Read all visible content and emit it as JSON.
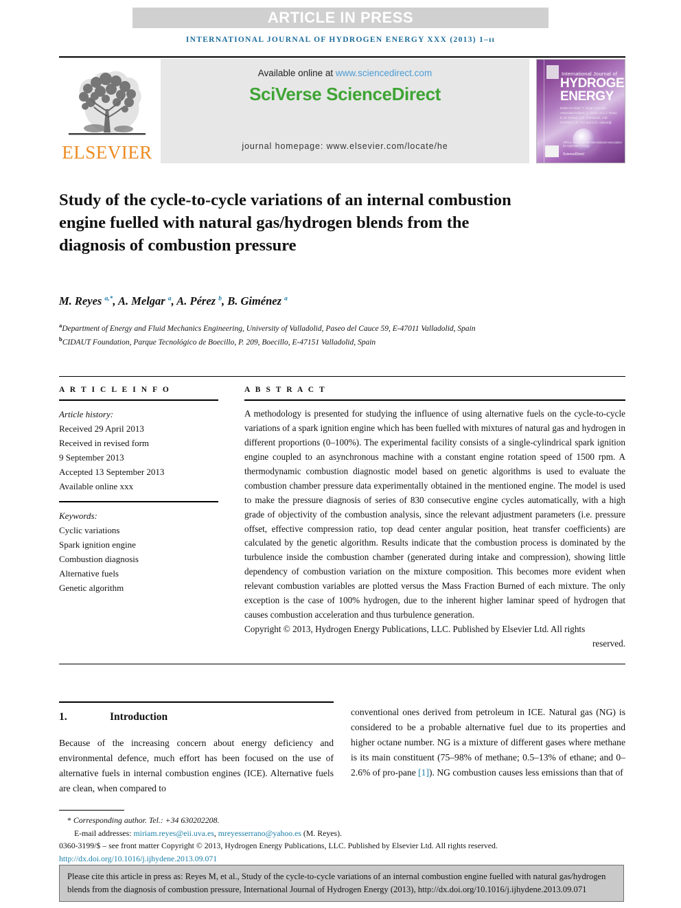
{
  "banner": {
    "article_in_press": "ARTICLE IN PRESS",
    "running_head": "INTERNATIONAL JOURNAL OF HYDROGEN ENERGY XXX (2013) 1–ıı"
  },
  "masthead": {
    "publisher_name": "ELSEVIER",
    "publisher_logo_icon": "elsevier-tree-icon",
    "available_online_prefix": "Available online at ",
    "sciencedirect_url": "www.sciencedirect.com",
    "sciverse_logo": "SciVerse ScienceDirect",
    "journal_homepage": "journal homepage: www.elsevier.com/locate/he",
    "cover": {
      "top_line": "International Journal of",
      "title_line1": "HYDROGEN",
      "title_line2": "ENERGY",
      "editors": "Editor-in-Chief: T. Nejat Veziroğlu    Associate Editors: S. Dunn, D.A.J. Rand, K.-D. Kreuer, A.E. Abasaeed, J.W. Sheffield, I.E. Trel and D.O. Aykuzdğ",
      "ihe_mark": "IAHE",
      "sciencedirect_mark": "ScienceDirect",
      "associated_with": "Official Journal of the International Association for Hydrogen Energy"
    }
  },
  "article": {
    "title": "Study of the cycle-to-cycle variations of an internal combustion engine fuelled with natural gas/hydrogen blends from the diagnosis of combustion pressure",
    "authors_html": "M. Reyes <sup>a,*</sup>, A. Melgar <sup>a</sup>, A. Pérez <sup>b</sup>, B. Giménez <sup>a</sup>",
    "affiliation_a": "Department of Energy and Fluid Mechanics Engineering, University of Valladolid, Paseo del Cauce 59, E-47011 Valladolid, Spain",
    "affiliation_b": "CIDAUT Foundation, Parque Tecnológico de Boecillo, P. 209, Boecillo, E-47151 Valladolid, Spain"
  },
  "article_info": {
    "heading": "A R T I C L E   I N F O",
    "history_label": "Article history:",
    "history": [
      "Received 29 April 2013",
      "Received in revised form",
      "9 September 2013",
      "Accepted 13 September 2013",
      "Available online xxx"
    ],
    "keywords_label": "Keywords:",
    "keywords": [
      "Cyclic variations",
      "Spark ignition engine",
      "Combustion diagnosis",
      "Alternative fuels",
      "Genetic algorithm"
    ]
  },
  "abstract": {
    "heading": "A B S T R A C T",
    "body": "A methodology is presented for studying the influence of using alternative fuels on the cycle-to-cycle variations of a spark ignition engine which has been fuelled with mixtures of natural gas and hydrogen in different proportions (0–100%). The experimental facility consists of a single-cylindrical spark ignition engine coupled to an asynchronous machine with a constant engine rotation speed of 1500 rpm. A thermodynamic combustion diagnostic model based on genetic algorithms is used to evaluate the combustion chamber pressure data experimentally obtained in the mentioned engine. The model is used to make the pressure diagnosis of series of 830 consecutive engine cycles automatically, with a high grade of objectivity of the combustion analysis, since the relevant adjustment parameters (i.e. pressure offset, effective compression ratio, top dead center angular position, heat transfer coefficients) are calculated by the genetic algorithm. Results indicate that the combustion process is dominated by the turbulence inside the combustion chamber (generated during intake and compression), showing little dependency of combustion variation on the mixture composition. This becomes more evident when relevant combustion variables are plotted versus the Mass Fraction Burned of each mixture. The only exception is the case of 100% hydrogen, due to the inherent higher laminar speed of hydrogen that causes combustion acceleration and thus turbulence generation.",
    "copyright_main": "Copyright © 2013, Hydrogen Energy Publications, LLC. Published by Elsevier Ltd. All rights",
    "copyright_tail": "reserved."
  },
  "introduction": {
    "number": "1.",
    "title": "Introduction",
    "left_paragraph": "Because of the increasing concern about energy deficiency and environmental defence, much effort has been focused on the use of alternative fuels in internal combustion engines (ICE). Alternative fuels are clean, when compared to",
    "right_paragraph_part1": "conventional ones derived from petroleum in ICE. Natural gas (NG) is considered to be a probable alternative fuel due to its properties and higher octane number. NG is a mixture of different gases where methane is its main constituent (75–98% of methane; 0.5–13% of ethane; and 0–2.6% of pro-pane ",
    "right_reference": "[1]",
    "right_paragraph_part2": "). NG combustion causes less emissions than that of"
  },
  "footnotes": {
    "corresponding": "Corresponding author. Tel.: +34 630202208.",
    "email_label": "E-mail addresses: ",
    "email1": "miriam.reyes@eii.uva.es",
    "email_sep": ", ",
    "email2": "mreyesserrano@yahoo.es",
    "email_suffix": " (M. Reyes).",
    "issn_line": "0360-3199/$ – see front matter Copyright © 2013, Hydrogen Energy Publications, LLC. Published by Elsevier Ltd. All rights reserved.",
    "doi": "http://dx.doi.org/10.1016/j.ijhydene.2013.09.071"
  },
  "citation_box": {
    "text": "Please cite this article in press as: Reyes M, et al., Study of the cycle-to-cycle variations of an internal combustion engine fuelled with natural gas/hydrogen blends from the diagnosis of combustion pressure, International Journal of Hydrogen Energy (2013), http://dx.doi.org/10.1016/j.ijhydene.2013.09.071"
  },
  "colors": {
    "journal_blue": "#1b6c9c",
    "elsevier_orange": "#ec8b22",
    "sciencedirect_green": "#3fa435",
    "link_blue": "#1b7fa8",
    "banner_gray": "#d0d0d0",
    "panel_gray": "#e7e7e7",
    "cite_box_gray": "#c9c9c9"
  }
}
